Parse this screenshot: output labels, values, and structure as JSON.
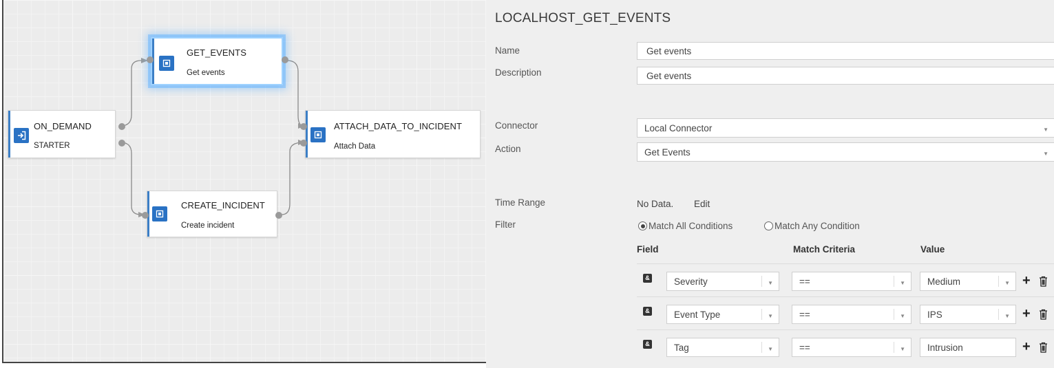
{
  "workflow": {
    "nodes": [
      {
        "id": "on_demand",
        "title": "ON_DEMAND",
        "subtitle": "STARTER",
        "icon": "enter-icon"
      },
      {
        "id": "get_events",
        "title": "GET_EVENTS",
        "subtitle": "Get events",
        "icon": "connector-icon",
        "selected": true
      },
      {
        "id": "attach",
        "title": "ATTACH_DATA_TO_INCIDENT",
        "subtitle": "Attach Data",
        "icon": "connector-icon"
      },
      {
        "id": "create_incident",
        "title": "CREATE_INCIDENT",
        "subtitle": "Create incident",
        "icon": "connector-icon"
      }
    ]
  },
  "panel": {
    "title": "LOCALHOST_GET_EVENTS",
    "name_label": "Name",
    "name_value": "Get events",
    "description_label": "Description",
    "description_value": "Get events",
    "connector_label": "Connector",
    "connector_value": "Local Connector",
    "action_label": "Action",
    "action_value": "Get Events",
    "time_range_label": "Time Range",
    "time_range_value": "No Data.",
    "time_range_edit": "Edit",
    "filter_label": "Filter",
    "match_all": "Match All Conditions",
    "match_any": "Match Any Condition",
    "match_all_selected": true,
    "columns": {
      "field": "Field",
      "criteria": "Match Criteria",
      "value": "Value"
    },
    "conditions": [
      {
        "field": "Severity",
        "criteria": "==",
        "value": "Medium",
        "value_dropdown": true
      },
      {
        "field": "Event Type",
        "criteria": "==",
        "value": "IPS",
        "value_dropdown": true
      },
      {
        "field": "Tag",
        "criteria": "==",
        "value": "Intrusion",
        "value_dropdown": false
      }
    ],
    "and_badge": "&",
    "caret": "▼",
    "plus": "+"
  },
  "colors": {
    "accent": "#2a72c4",
    "selected_glow": "#5aafff",
    "panel_bg": "#efefef"
  }
}
